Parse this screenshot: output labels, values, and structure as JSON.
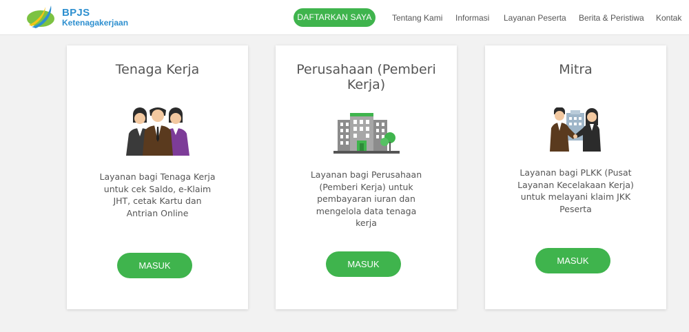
{
  "header": {
    "logo": {
      "brand": "BPJS",
      "sub": "Ketenagakerjaan",
      "icon": "bpjs-swoosh-logo"
    },
    "register_label": "DAFTARKAN SAYA",
    "nav": [
      "Tentang Kami",
      "Informasi",
      "Layanan Peserta",
      "Berita & Peristiwa",
      "Kontak"
    ]
  },
  "cards": [
    {
      "title": "Tenaga Kerja",
      "illustration": "workers-group-icon",
      "description": "Layanan bagi Tenaga Kerja untuk cek Saldo, e-Klaim JHT, cetak Kartu dan Antrian Online",
      "button": "MASUK"
    },
    {
      "title": "Perusahaan (Pemberi Kerja)",
      "illustration": "office-buildings-icon",
      "description": "Layanan bagi Perusahaan (Pemberi Kerja) untuk pembayaran iuran dan mengelola data tenaga kerja",
      "button": "MASUK"
    },
    {
      "title": "Mitra",
      "illustration": "partnership-handshake-icon",
      "description": "Layanan bagi PLKK (Pusat Layanan Kecelakaan Kerja) untuk melayani klaim JKK Peserta",
      "button": "MASUK"
    }
  ],
  "colors": {
    "accent_green": "#3fb44d",
    "brand_blue": "#2d8fcf",
    "background": "#f2f2f2"
  }
}
